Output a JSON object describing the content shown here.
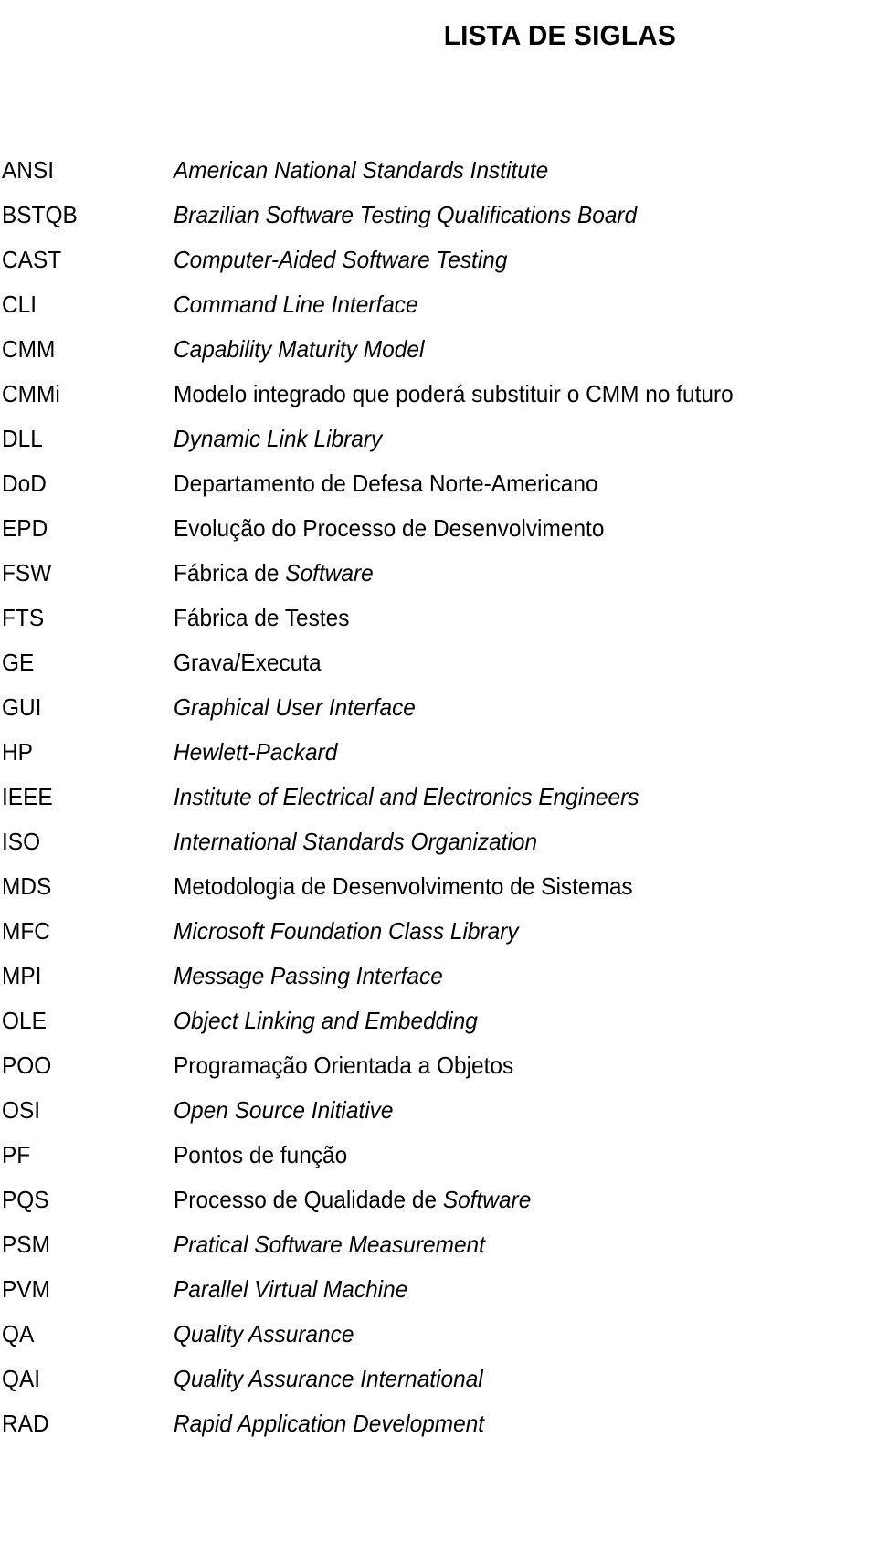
{
  "document": {
    "title": "LISTA DE SIGLAS",
    "background_color": "#ffffff",
    "text_color": "#000000"
  },
  "glossary": {
    "entries": [
      {
        "acronym": "ANSI",
        "definition": "American National Standards Institute",
        "style": "italic"
      },
      {
        "acronym": "BSTQB",
        "definition": "Brazilian Software Testing Qualifications Board",
        "style": "italic"
      },
      {
        "acronym": "CAST",
        "definition": "Computer-Aided Software Testing",
        "style": "italic"
      },
      {
        "acronym": "CLI",
        "definition": "Command Line Interface",
        "style": "italic"
      },
      {
        "acronym": "CMM",
        "definition": "Capability Maturity Model",
        "style": "italic"
      },
      {
        "acronym": "CMMi",
        "definition": "Modelo integrado que poderá substituir o CMM no futuro",
        "style": "roman"
      },
      {
        "acronym": "DLL",
        "definition": "Dynamic Link Library",
        "style": "italic"
      },
      {
        "acronym": "DoD",
        "definition": "Departamento de Defesa Norte-Americano",
        "style": "roman"
      },
      {
        "acronym": "EPD",
        "definition": "Evolução do Processo de Desenvolvimento",
        "style": "roman"
      },
      {
        "acronym": "FSW",
        "definition": "Fábrica de Software",
        "style": "mixed",
        "roman_prefix": "Fábrica de ",
        "italic_suffix": "Software"
      },
      {
        "acronym": "FTS",
        "definition": "Fábrica de Testes",
        "style": "roman"
      },
      {
        "acronym": "GE",
        "definition": "Grava/Executa",
        "style": "roman"
      },
      {
        "acronym": "GUI",
        "definition": "Graphical User Interface",
        "style": "italic"
      },
      {
        "acronym": "HP",
        "definition": "Hewlett-Packard",
        "style": "italic"
      },
      {
        "acronym": "IEEE",
        "definition": "Institute of Electrical and Electronics Engineers",
        "style": "italic"
      },
      {
        "acronym": "ISO",
        "definition": "International Standards Organization",
        "style": "italic"
      },
      {
        "acronym": "MDS",
        "definition": "Metodologia de Desenvolvimento de Sistemas",
        "style": "roman"
      },
      {
        "acronym": "MFC",
        "definition": "Microsoft Foundation Class Library",
        "style": "italic"
      },
      {
        "acronym": "MPI",
        "definition": "Message Passing Interface",
        "style": "italic"
      },
      {
        "acronym": "OLE",
        "definition": "Object Linking and Embedding",
        "style": "italic"
      },
      {
        "acronym": "POO",
        "definition": "Programação Orientada a Objetos",
        "style": "roman"
      },
      {
        "acronym": "OSI",
        "definition": "Open Source Initiative",
        "style": "italic"
      },
      {
        "acronym": "PF",
        "definition": "Pontos de função",
        "style": "roman"
      },
      {
        "acronym": "PQS",
        "definition": "Processo de Qualidade de Software",
        "style": "mixed",
        "roman_prefix": "Processo de Qualidade de ",
        "italic_suffix": "Software"
      },
      {
        "acronym": "PSM",
        "definition": "Pratical Software Measurement",
        "style": "italic"
      },
      {
        "acronym": "PVM",
        "definition": "Parallel Virtual Machine",
        "style": "italic"
      },
      {
        "acronym": "QA",
        "definition": "Quality Assurance",
        "style": "italic"
      },
      {
        "acronym": "QAI",
        "definition": "Quality Assurance International",
        "style": "italic"
      },
      {
        "acronym": "RAD",
        "definition": "Rapid Application Development",
        "style": "italic"
      }
    ]
  }
}
